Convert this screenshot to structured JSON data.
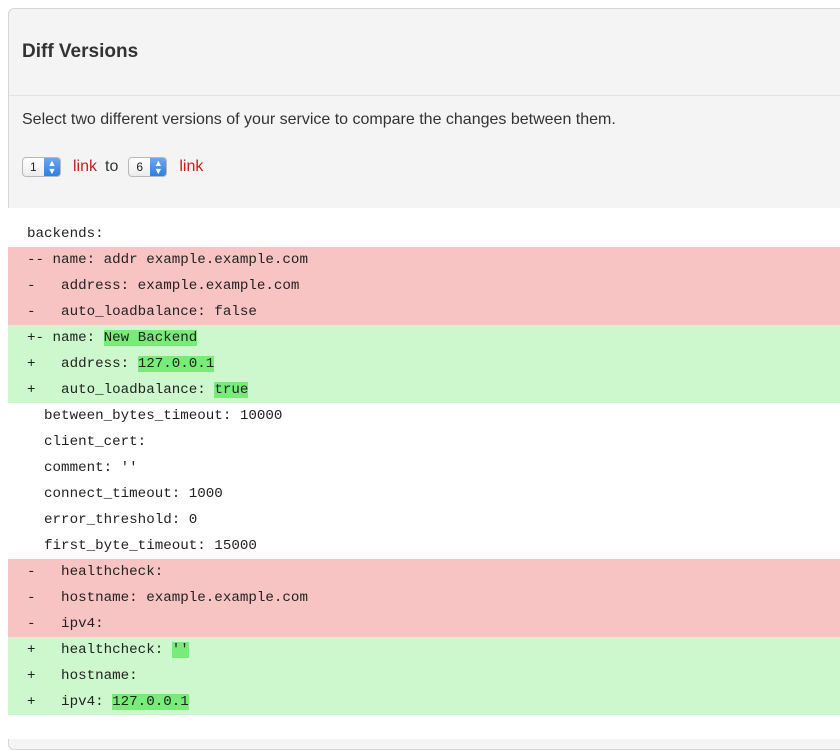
{
  "panel": {
    "title": "Diff Versions",
    "description": "Select two different versions of your service to compare the changes between them."
  },
  "versions": {
    "from_value": "1",
    "from_link": "link",
    "to_label": "to",
    "to_value": "6",
    "to_link": "link"
  },
  "diff": {
    "lines": [
      {
        "type": "context",
        "prefix": "",
        "text": "backends:",
        "highlight": ""
      },
      {
        "type": "removed",
        "prefix": "--",
        "text": " name: addr example.example.com",
        "highlight": ""
      },
      {
        "type": "removed",
        "prefix": "-",
        "text": "   address: example.example.com",
        "highlight": ""
      },
      {
        "type": "removed",
        "prefix": "-",
        "text": "   auto_loadbalance: false",
        "highlight": ""
      },
      {
        "type": "added",
        "prefix": "+-",
        "text": " name: ",
        "highlight": "New Backend"
      },
      {
        "type": "added",
        "prefix": "+",
        "text": "   address: ",
        "highlight": "127.0.0.1"
      },
      {
        "type": "added",
        "prefix": "+",
        "text": "   auto_loadbalance: ",
        "highlight": "true"
      },
      {
        "type": "context",
        "prefix": "",
        "text": "  between_bytes_timeout: 10000",
        "highlight": ""
      },
      {
        "type": "context",
        "prefix": "",
        "text": "  client_cert:",
        "highlight": ""
      },
      {
        "type": "context",
        "prefix": "",
        "text": "  comment: ''",
        "highlight": ""
      },
      {
        "type": "context",
        "prefix": "",
        "text": "  connect_timeout: 1000",
        "highlight": ""
      },
      {
        "type": "context",
        "prefix": "",
        "text": "  error_threshold: 0",
        "highlight": ""
      },
      {
        "type": "context",
        "prefix": "",
        "text": "  first_byte_timeout: 15000",
        "highlight": ""
      },
      {
        "type": "removed",
        "prefix": "-",
        "text": "   healthcheck:",
        "highlight": ""
      },
      {
        "type": "removed",
        "prefix": "-",
        "text": "   hostname: example.example.com",
        "highlight": ""
      },
      {
        "type": "removed",
        "prefix": "-",
        "text": "   ipv4:",
        "highlight": ""
      },
      {
        "type": "added",
        "prefix": "+",
        "text": "   healthcheck: ",
        "highlight": "''"
      },
      {
        "type": "added",
        "prefix": "+",
        "text": "   hostname:",
        "highlight": ""
      },
      {
        "type": "added",
        "prefix": "+",
        "text": "   ipv4: ",
        "highlight": "127.0.0.1"
      }
    ]
  },
  "colors": {
    "removed_bg": "#f8c3c3",
    "added_bg": "#cdf8cd",
    "added_highlight": "#78ec78",
    "link": "#cc1b1b",
    "stepper": "#2f7ee0"
  }
}
